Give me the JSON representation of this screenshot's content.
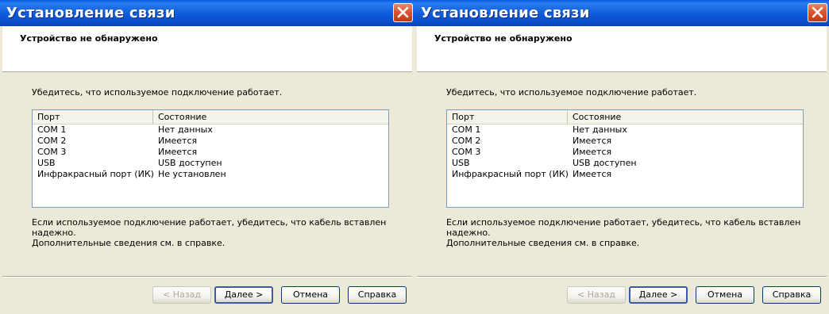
{
  "dialogs": [
    {
      "title": "Установление связи",
      "header": "Устройство не обнаружено",
      "instruction": "Убедитесь, что используемое подключение работает.",
      "columns": [
        "Порт",
        "Состояние"
      ],
      "rows": [
        {
          "port": "COM 1",
          "status": "Нет данных"
        },
        {
          "port": "COM 2",
          "status": "Имеется"
        },
        {
          "port": "COM 3",
          "status": "Имеется"
        },
        {
          "port": "USB",
          "status": "USB доступен"
        },
        {
          "port": "Инфракрасный порт (ИК)",
          "status": "Не установлен"
        }
      ],
      "note_line1": "Если используемое подключение работает, убедитесь, что кабель вставлен надежно.",
      "note_line2": "Дополнительные сведения см. в справке.",
      "buttons": {
        "back": "< Назад",
        "next": "Далее >",
        "cancel": "Отмена",
        "help": "Справка"
      }
    },
    {
      "title": "Установление связи",
      "header": "Устройство не обнаружено",
      "instruction": "Убедитесь, что используемое подключение работает.",
      "columns": [
        "Порт",
        "Состояние"
      ],
      "rows": [
        {
          "port": "COM 1",
          "status": "Нет данных"
        },
        {
          "port": "COM 2",
          "status": "Имеется"
        },
        {
          "port": "COM 3",
          "status": "Имеется"
        },
        {
          "port": "USB",
          "status": "USB доступен"
        },
        {
          "port": "Инфракрасный порт (ИК)",
          "status": "Имеется"
        }
      ],
      "note_line1": "Если используемое подключение работает, убедитесь, что кабель вставлен надежно.",
      "note_line2": "Дополнительные сведения см. в справке.",
      "buttons": {
        "back": "< Назад",
        "next": "Далее >",
        "cancel": "Отмена",
        "help": "Справка"
      }
    }
  ],
  "colors": {
    "titlebar": "#0a5ce3",
    "dialog_bg": "#ece9d8",
    "close_button": "#d9562f",
    "list_border": "#7f9db9"
  },
  "icons": {
    "close": "close-icon"
  }
}
